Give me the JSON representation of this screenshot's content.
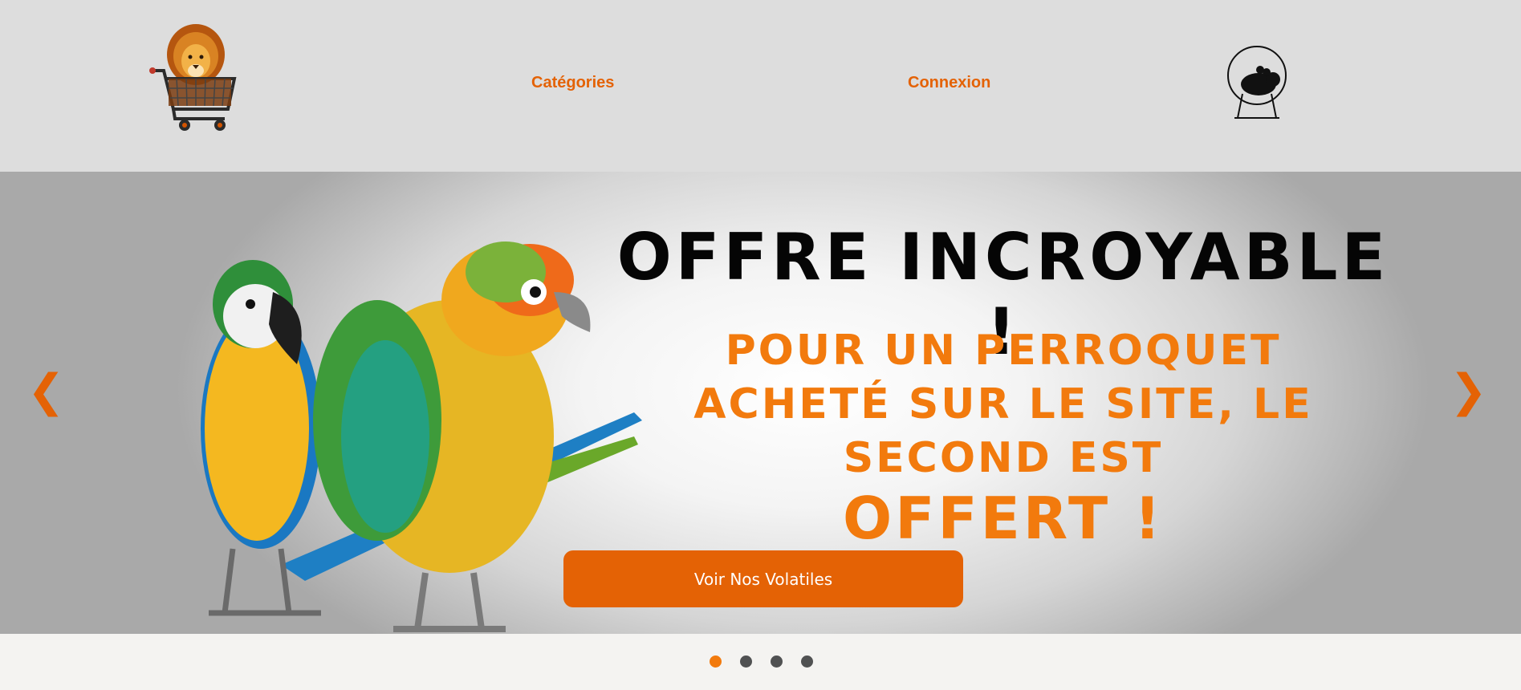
{
  "header": {
    "nav": [
      {
        "label": "Catégories"
      },
      {
        "label": "Connexion"
      }
    ]
  },
  "hero": {
    "title": "OFFRE INCROYABLE !",
    "subtitle": "POUR UN PERROQUET ACHETÉ SUR LE SITE, LE SECOND EST",
    "offer": "OFFERT !",
    "cta_label": "Voir Nos Volatiles",
    "prev_arrow": "❮",
    "next_arrow": "❯"
  },
  "carousel": {
    "slide_count": 4,
    "active_index": 0
  },
  "colors": {
    "accent": "#e46205",
    "headline_orange": "#f27a0d",
    "header_bg": "#dddddd",
    "dot_inactive": "#505152"
  },
  "icons": {
    "logo": "lion-shopping-cart-logo",
    "account": "hamster-wheel-icon"
  }
}
